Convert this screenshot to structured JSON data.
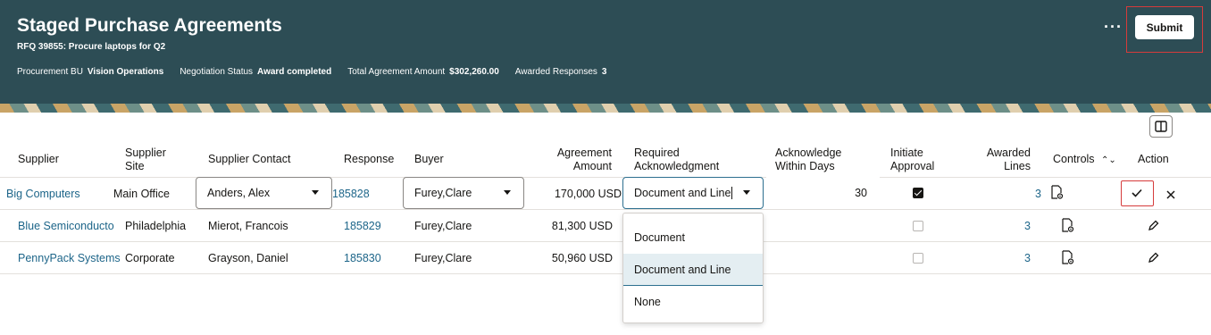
{
  "header": {
    "title": "Staged Purchase Agreements",
    "subtitle": "RFQ 39855: Procure laptops for Q2",
    "meta": [
      {
        "key": "Procurement BU",
        "value": "Vision Operations"
      },
      {
        "key": "Negotiation Status",
        "value": "Award completed"
      },
      {
        "key": "Total Agreement Amount",
        "value": "$302,260.00"
      },
      {
        "key": "Awarded Responses",
        "value": "3"
      }
    ],
    "more_label": "···",
    "submit_label": "Submit"
  },
  "columns": {
    "supplier": "Supplier",
    "supplier_site": "Supplier\nSite",
    "supplier_contact": "Supplier Contact",
    "response": "Response",
    "buyer": "Buyer",
    "agreement_amount": "Agreement\nAmount",
    "required_ack": "Required\nAcknowledgment",
    "ack_within_days": "Acknowledge\nWithin Days",
    "initiate_approval": "Initiate\nApproval",
    "awarded_lines": "Awarded\nLines",
    "controls": "Controls",
    "action": "Action"
  },
  "rows": [
    {
      "supplier": "Big Computers",
      "site": "Main Office",
      "contact": "Anders, Alex",
      "response": "185828",
      "buyer": "Furey,Clare",
      "amount": "170,000 USD",
      "ack": "Document and Line",
      "days": "30",
      "approval": true,
      "lines": "3"
    },
    {
      "supplier": "Blue Semiconductor",
      "site": "Philadelphia",
      "contact": "Mierot, Francois",
      "response": "185829",
      "buyer": "Furey,Clare",
      "amount": "81,300 USD",
      "approval": false,
      "lines": "3"
    },
    {
      "supplier": "PennyPack Systems",
      "site": "Corporate",
      "contact": "Grayson, Daniel",
      "response": "185830",
      "buyer": "Furey,Clare",
      "amount": "50,960 USD",
      "approval": false,
      "lines": "3"
    }
  ],
  "ack_options": [
    "Document",
    "Document and Line",
    "None"
  ],
  "colors": {
    "header_bg": "#2d4d55",
    "link": "#1d6589",
    "highlight": "#d63b3b"
  }
}
